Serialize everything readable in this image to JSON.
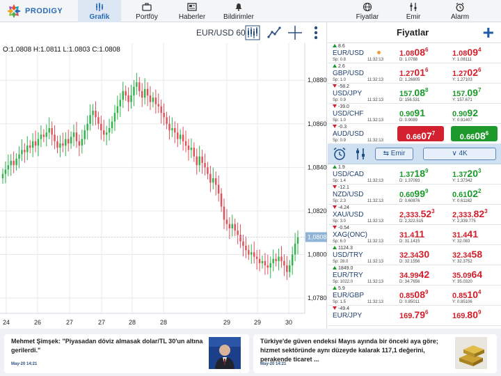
{
  "app": {
    "logo_text": "PRODIGY"
  },
  "nav": {
    "tabs": [
      {
        "label": "Grafik",
        "icon": "chart-bars-icon",
        "active": true
      },
      {
        "label": "Portföy",
        "icon": "briefcase-icon",
        "active": false
      },
      {
        "label": "Haberler",
        "icon": "newspaper-icon",
        "active": false
      },
      {
        "label": "Bildirimler",
        "icon": "bell-icon",
        "active": false
      },
      {
        "label": "Fiyatlar",
        "icon": "globe-icon",
        "active": false
      },
      {
        "label": "Emir",
        "icon": "sliders-icon",
        "active": false
      },
      {
        "label": "Alarm",
        "icon": "alarm-clock-icon",
        "active": false
      }
    ]
  },
  "chart": {
    "pair_label": "EUR/USD 60",
    "ohlc_text": "O:1.0808 H:1.0811 L:1.0803 C:1.0808",
    "current_price_label": "1,0808",
    "toolbar_icons": [
      "candlestick-icon",
      "line-draw-icon",
      "crosshair-icon",
      "more-vertical-icon"
    ]
  },
  "chart_data": {
    "type": "candlestick",
    "title": "",
    "xlabel": "",
    "ylabel": "",
    "x_tick_labels": [
      "24",
      "26",
      "27",
      "27",
      "28",
      "28",
      "29",
      "29",
      "30"
    ],
    "y_tick_labels": [
      "1,0880",
      "1,0860",
      "1,0840",
      "1,0820",
      "1,0800",
      "1,0780"
    ],
    "y_ticks": [
      1.088,
      1.086,
      1.084,
      1.082,
      1.08,
      1.078
    ],
    "ylim": [
      1.0773,
      1.0897
    ],
    "grid": true,
    "up_color": "#2fb34a",
    "down_color": "#e0505a",
    "closes": [
      1.0837,
      1.0839,
      1.0841,
      1.0843,
      1.0841,
      1.0844,
      1.0846,
      1.0848,
      1.0847,
      1.085,
      1.0849,
      1.0852,
      1.085,
      1.0853,
      1.0855,
      1.0854,
      1.0856,
      1.0858,
      1.0855,
      1.0852,
      1.0849,
      1.0851,
      1.085,
      1.0853,
      1.0851,
      1.0854,
      1.0856,
      1.0852,
      1.085,
      1.0853,
      1.0857,
      1.086,
      1.0864,
      1.0866,
      1.0863,
      1.086,
      1.0857,
      1.0855,
      1.0856,
      1.0858,
      1.0861,
      1.0865,
      1.0868,
      1.0871,
      1.0875,
      1.0873,
      1.087,
      1.0873,
      1.0877,
      1.0879,
      1.0875,
      1.0872,
      1.0876,
      1.0873,
      1.087,
      1.0872,
      1.0869,
      1.0868,
      1.0865,
      1.0863,
      1.086,
      1.0857,
      1.0858,
      1.0856,
      1.0853,
      1.0855,
      1.0852,
      1.085,
      1.0848,
      1.0849,
      1.0845,
      1.0841,
      1.0845,
      1.0842,
      1.084,
      1.0837,
      1.0833,
      1.0835,
      1.0832,
      1.0828,
      1.0822,
      1.0816,
      1.0814,
      1.0812,
      1.0814,
      1.0811,
      1.0809,
      1.0806,
      1.0804,
      1.0802,
      1.08,
      1.0801,
      1.0799,
      1.0798,
      1.0796,
      1.0797,
      1.0795,
      1.0794,
      1.0796,
      1.0798,
      1.0797,
      1.0799,
      1.0797,
      1.0795,
      1.0792,
      1.0795,
      1.08,
      1.0805,
      1.0808
    ]
  },
  "prices": {
    "title": "Fiyatlar",
    "add_icon": "plus-icon",
    "rows": [
      {
        "dir": "up",
        "change": "8.6",
        "symbol": "EUR/USD",
        "spread": "Sp: 0.8",
        "time": "11:32:13",
        "dot": true,
        "bid_pre": "1.08",
        "bid_big": "08",
        "bid_sup": "6",
        "bid_color": "red",
        "ask_pre": "1.08",
        "ask_big": "09",
        "ask_sup": "4",
        "ask_color": "red",
        "low": "D: 1.0788",
        "high": "Y: 1.08111"
      },
      {
        "dir": "up",
        "change": "2.6",
        "symbol": "GBP/USD",
        "spread": "Sp: 1.0",
        "time": "11:32:13",
        "dot": false,
        "bid_pre": "1.27",
        "bid_big": "01",
        "bid_sup": "6",
        "bid_color": "red",
        "ask_pre": "1.27",
        "ask_big": "02",
        "ask_sup": "6",
        "ask_color": "red",
        "low": "D: 1.26805",
        "high": "Y: 1.27103"
      },
      {
        "dir": "down",
        "change": "-58.2",
        "symbol": "USD/JPY",
        "spread": "Sp: 0.9",
        "time": "11:32:13",
        "dot": false,
        "bid_pre": "157.",
        "bid_big": "08",
        "bid_sup": "8",
        "bid_color": "green",
        "ask_pre": "157.",
        "ask_big": "09",
        "ask_sup": "7",
        "ask_color": "green",
        "low": "D: 156.531",
        "high": "Y: 157.671"
      },
      {
        "dir": "down",
        "change": "-39.0",
        "symbol": "USD/CHF",
        "spread": "Sp: 1.0",
        "time": "11:32:13",
        "dot": false,
        "bid_pre": "0.90",
        "bid_big": "91",
        "bid_sup": "",
        "bid_color": "green",
        "ask_pre": "0.90",
        "ask_big": "92",
        "ask_sup": "",
        "ask_color": "green",
        "low": "D: 0.9089",
        "high": "Y: 0.91407"
      }
    ],
    "selected": {
      "dir": "down",
      "change": "-0.3",
      "symbol": "AUD/USD",
      "spread": "Sp: 0.9",
      "time": "11:32:13",
      "bid_pre": "0.66",
      "bid_big": "07",
      "bid_sup": "7",
      "ask_pre": "0.66",
      "ask_big": "08",
      "ask_sup": "6"
    },
    "actionbar": {
      "emir_label": "Emir",
      "qty_label": "4K",
      "alarm_icon": "alarm-clock-icon",
      "sliders_icon": "sliders-icon"
    },
    "rows2": [
      {
        "dir": "up",
        "change": "1.9",
        "symbol": "USD/CAD",
        "spread": "Sp: 1.4",
        "time": "11:32:13",
        "bid_pre": "1.37",
        "bid_big": "18",
        "bid_sup": "9",
        "bid_color": "green",
        "ask_pre": "1.37",
        "ask_big": "20",
        "ask_sup": "3",
        "ask_color": "green",
        "low": "D: 1.37093",
        "high": "Y: 1.37342"
      },
      {
        "dir": "down",
        "change": "-12.1",
        "symbol": "NZD/USD",
        "spread": "Sp: 2.3",
        "time": "11:32:13",
        "bid_pre": "0.60",
        "bid_big": "99",
        "bid_sup": "9",
        "bid_color": "green",
        "ask_pre": "0.61",
        "ask_big": "02",
        "ask_sup": "2",
        "ask_color": "green",
        "low": "D: 0.60876",
        "high": "Y: 0.61162"
      },
      {
        "dir": "down",
        "change": "-4.24",
        "symbol": "XAU/USD",
        "spread": "Sp: 3.0",
        "time": "11:32:13",
        "bid_pre": "2,333.",
        "bid_big": "52",
        "bid_sup": "3",
        "bid_color": "red",
        "ask_pre": "2,333.",
        "ask_big": "82",
        "ask_sup": "3",
        "ask_color": "red",
        "low": "D: 2,322.515",
        "high": "Y: 2,339.775"
      },
      {
        "dir": "down",
        "change": "-0.54",
        "symbol": "XAG(ONC)",
        "spread": "Sp: 6.0",
        "time": "11:32:13",
        "bid_pre": "31.4",
        "bid_big": "11",
        "bid_sup": "",
        "bid_color": "red",
        "ask_pre": "31.4",
        "ask_big": "41",
        "ask_sup": "",
        "ask_color": "red",
        "low": "D: 31.1415",
        "high": "Y: 32.083"
      },
      {
        "dir": "up",
        "change": "1124.3",
        "symbol": "USD/TRY",
        "spread": "Sp: 28.0",
        "time": "11:32:13",
        "bid_pre": "32.34",
        "bid_big": "30",
        "bid_sup": "",
        "bid_color": "red",
        "ask_pre": "32.34",
        "ask_big": "58",
        "ask_sup": "",
        "ask_color": "red",
        "low": "D: 32.1556",
        "high": "Y: 32.3752"
      },
      {
        "dir": "up",
        "change": "1849.0",
        "symbol": "EUR/TRY",
        "spread": "Sp: 1022.0",
        "time": "11:32:13",
        "bid_pre": "34.99",
        "bid_big": "42",
        "bid_sup": "",
        "bid_color": "red",
        "ask_pre": "35.09",
        "ask_big": "64",
        "ask_sup": "",
        "ask_color": "red",
        "low": "D: 34.7656",
        "high": "Y: 35.0320"
      },
      {
        "dir": "up",
        "change": "5.9",
        "symbol": "EUR/GBP",
        "spread": "Sp: 1.5",
        "time": "11:32:13",
        "bid_pre": "0.85",
        "bid_big": "08",
        "bid_sup": "9",
        "bid_color": "red",
        "ask_pre": "0.85",
        "ask_big": "10",
        "ask_sup": "4",
        "ask_color": "red",
        "low": "D: 0.85011",
        "high": "Y: 0.85106"
      },
      {
        "dir": "down",
        "change": "-49.4",
        "symbol": "EUR/JPY",
        "spread": "",
        "time": "",
        "bid_pre": "169.",
        "bid_big": "79",
        "bid_sup": "6",
        "bid_color": "red",
        "ask_pre": "169.",
        "ask_big": "80",
        "ask_sup": "9",
        "ask_color": "red",
        "low": "",
        "high": ""
      }
    ]
  },
  "news": [
    {
      "title": "Mehmet Şimşek: \"Piyasadan döviz almasak dolar/TL 30'un altına gerilerdi.\"",
      "date": "May-20 14:21",
      "thumb": "person-portrait-icon"
    },
    {
      "title": "Türkiye'de güven endeksi Mayıs ayında bir önceki aya göre; hizmet sektöründe aynı düzeyde kalarak 117,1 değerini, perakende ticaret ...",
      "date": "May-20 14:21",
      "thumb": "gold-bars-icon"
    }
  ],
  "colors": {
    "accent": "#2a6bb5",
    "up": "#199a2a",
    "down": "#d21e2a",
    "nav_bg": "#f4f5f7"
  }
}
